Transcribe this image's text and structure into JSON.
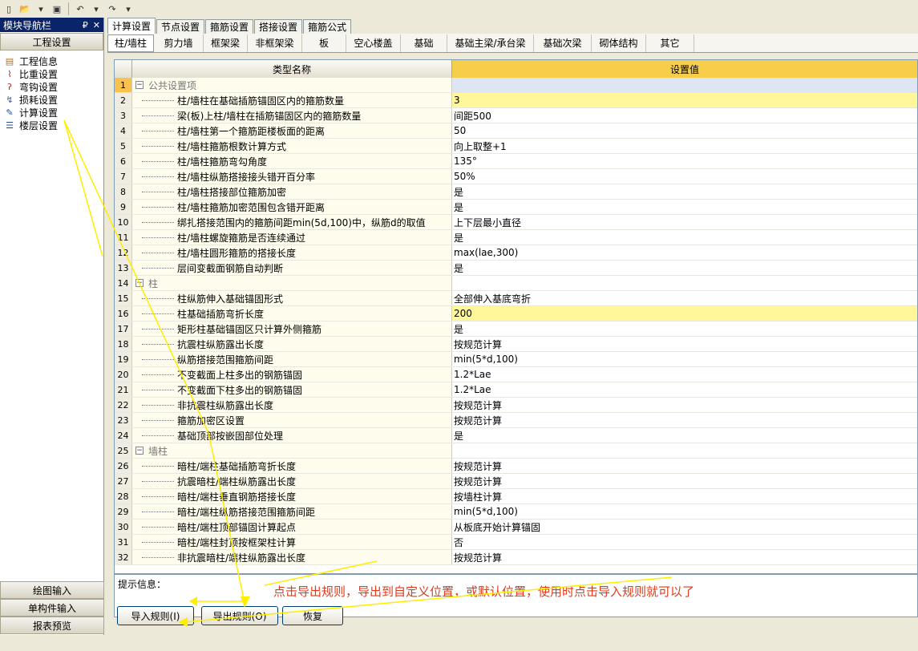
{
  "toolbar": {
    "icons": [
      "new-icon",
      "open-icon",
      "save-icon",
      "undo-icon",
      "redo-icon"
    ]
  },
  "nav": {
    "title": "模块导航栏",
    "pin": "₽",
    "close": "✕",
    "header": "工程设置",
    "items": [
      {
        "label": "工程信息",
        "icon": "doc-icon"
      },
      {
        "label": "比重设置",
        "icon": "rebar-icon"
      },
      {
        "label": "弯钩设置",
        "icon": "hook-icon"
      },
      {
        "label": "损耗设置",
        "icon": "loss-icon"
      },
      {
        "label": "计算设置",
        "icon": "calc-icon"
      },
      {
        "label": "楼层设置",
        "icon": "floor-icon"
      }
    ],
    "bottom": [
      "绘图输入",
      "单构件输入",
      "报表预览"
    ]
  },
  "tabs1": [
    "计算设置",
    "节点设置",
    "箍筋设置",
    "搭接设置",
    "箍筋公式"
  ],
  "tabs2": [
    {
      "label": "柱/墙柱",
      "w": 58
    },
    {
      "label": "剪力墙",
      "w": 62
    },
    {
      "label": "框架梁",
      "w": 55
    },
    {
      "label": "非框架梁",
      "w": 68
    },
    {
      "label": "板",
      "w": 55
    },
    {
      "label": "空心楼盖",
      "w": 68
    },
    {
      "label": "基础",
      "w": 58
    },
    {
      "label": "基础主梁/承台梁",
      "w": 108
    },
    {
      "label": "基础次梁",
      "w": 72
    },
    {
      "label": "砌体结构",
      "w": 68
    },
    {
      "label": "其它",
      "w": 60
    }
  ],
  "grid": {
    "header_name": "类型名称",
    "header_value": "设置值",
    "rows": [
      {
        "n": "1",
        "name": "公共设置项",
        "value": "",
        "group": true
      },
      {
        "n": "2",
        "name": "柱/墙柱在基础插筋锚固区内的箍筋数量",
        "value": "3",
        "hl": true
      },
      {
        "n": "3",
        "name": "梁(板)上柱/墙柱在插筋锚固区内的箍筋数量",
        "value": "间距500"
      },
      {
        "n": "4",
        "name": "柱/墙柱第一个箍筋距楼板面的距离",
        "value": "50"
      },
      {
        "n": "5",
        "name": "柱/墙柱箍筋根数计算方式",
        "value": "向上取整+1"
      },
      {
        "n": "6",
        "name": "柱/墙柱箍筋弯勾角度",
        "value": "135°"
      },
      {
        "n": "7",
        "name": "柱/墙柱纵筋搭接接头错开百分率",
        "value": "50%"
      },
      {
        "n": "8",
        "name": "柱/墙柱搭接部位箍筋加密",
        "value": "是"
      },
      {
        "n": "9",
        "name": "柱/墙柱箍筋加密范围包含错开距离",
        "value": "是"
      },
      {
        "n": "10",
        "name": "绑扎搭接范围内的箍筋间距min(5d,100)中，纵筋d的取值",
        "value": "上下层最小直径"
      },
      {
        "n": "11",
        "name": "柱/墙柱螺旋箍筋是否连续通过",
        "value": "是"
      },
      {
        "n": "12",
        "name": "柱/墙柱圆形箍筋的搭接长度",
        "value": "max(lae,300)"
      },
      {
        "n": "13",
        "name": "层间变截面钢筋自动判断",
        "value": "是"
      },
      {
        "n": "14",
        "name": "柱",
        "value": "",
        "group": true
      },
      {
        "n": "15",
        "name": "柱纵筋伸入基础锚固形式",
        "value": "全部伸入基底弯折"
      },
      {
        "n": "16",
        "name": "柱基础插筋弯折长度",
        "value": "200",
        "hl": true
      },
      {
        "n": "17",
        "name": "矩形柱基础锚固区只计算外侧箍筋",
        "value": "是"
      },
      {
        "n": "18",
        "name": "抗震柱纵筋露出长度",
        "value": "按规范计算"
      },
      {
        "n": "19",
        "name": "纵筋搭接范围箍筋间距",
        "value": "min(5*d,100)"
      },
      {
        "n": "20",
        "name": "不变截面上柱多出的钢筋锚固",
        "value": "1.2*Lae"
      },
      {
        "n": "21",
        "name": "不变截面下柱多出的钢筋锚固",
        "value": "1.2*Lae"
      },
      {
        "n": "22",
        "name": "非抗震柱纵筋露出长度",
        "value": "按规范计算"
      },
      {
        "n": "23",
        "name": "箍筋加密区设置",
        "value": "按规范计算"
      },
      {
        "n": "24",
        "name": "基础顶部按嵌固部位处理",
        "value": "是"
      },
      {
        "n": "25",
        "name": "墙柱",
        "value": "",
        "group": true
      },
      {
        "n": "26",
        "name": "暗柱/端柱基础插筋弯折长度",
        "value": "按规范计算"
      },
      {
        "n": "27",
        "name": "抗震暗柱/端柱纵筋露出长度",
        "value": "按规范计算"
      },
      {
        "n": "28",
        "name": "暗柱/端柱垂直钢筋搭接长度",
        "value": "按墙柱计算"
      },
      {
        "n": "29",
        "name": "暗柱/端柱纵筋搭接范围箍筋间距",
        "value": "min(5*d,100)"
      },
      {
        "n": "30",
        "name": "暗柱/端柱顶部锚固计算起点",
        "value": "从板底开始计算锚固"
      },
      {
        "n": "31",
        "name": "暗柱/端柱封顶按框架柱计算",
        "value": "否"
      },
      {
        "n": "32",
        "name": "非抗震暗柱/端柱纵筋露出长度",
        "value": "按规范计算"
      }
    ]
  },
  "hint": {
    "label": "提示信息：",
    "annotation": "点击导出规则，导出到自定义位置，或默认位置，使用时点击导入规则就可以了"
  },
  "buttons": {
    "import": "导入规则(I)",
    "export": "导出规则(O)",
    "restore": "恢复"
  },
  "colors": {
    "annotation": "#e03a1a",
    "arrow": "#ffee00",
    "header_value_bg": "#f7ce4a"
  }
}
